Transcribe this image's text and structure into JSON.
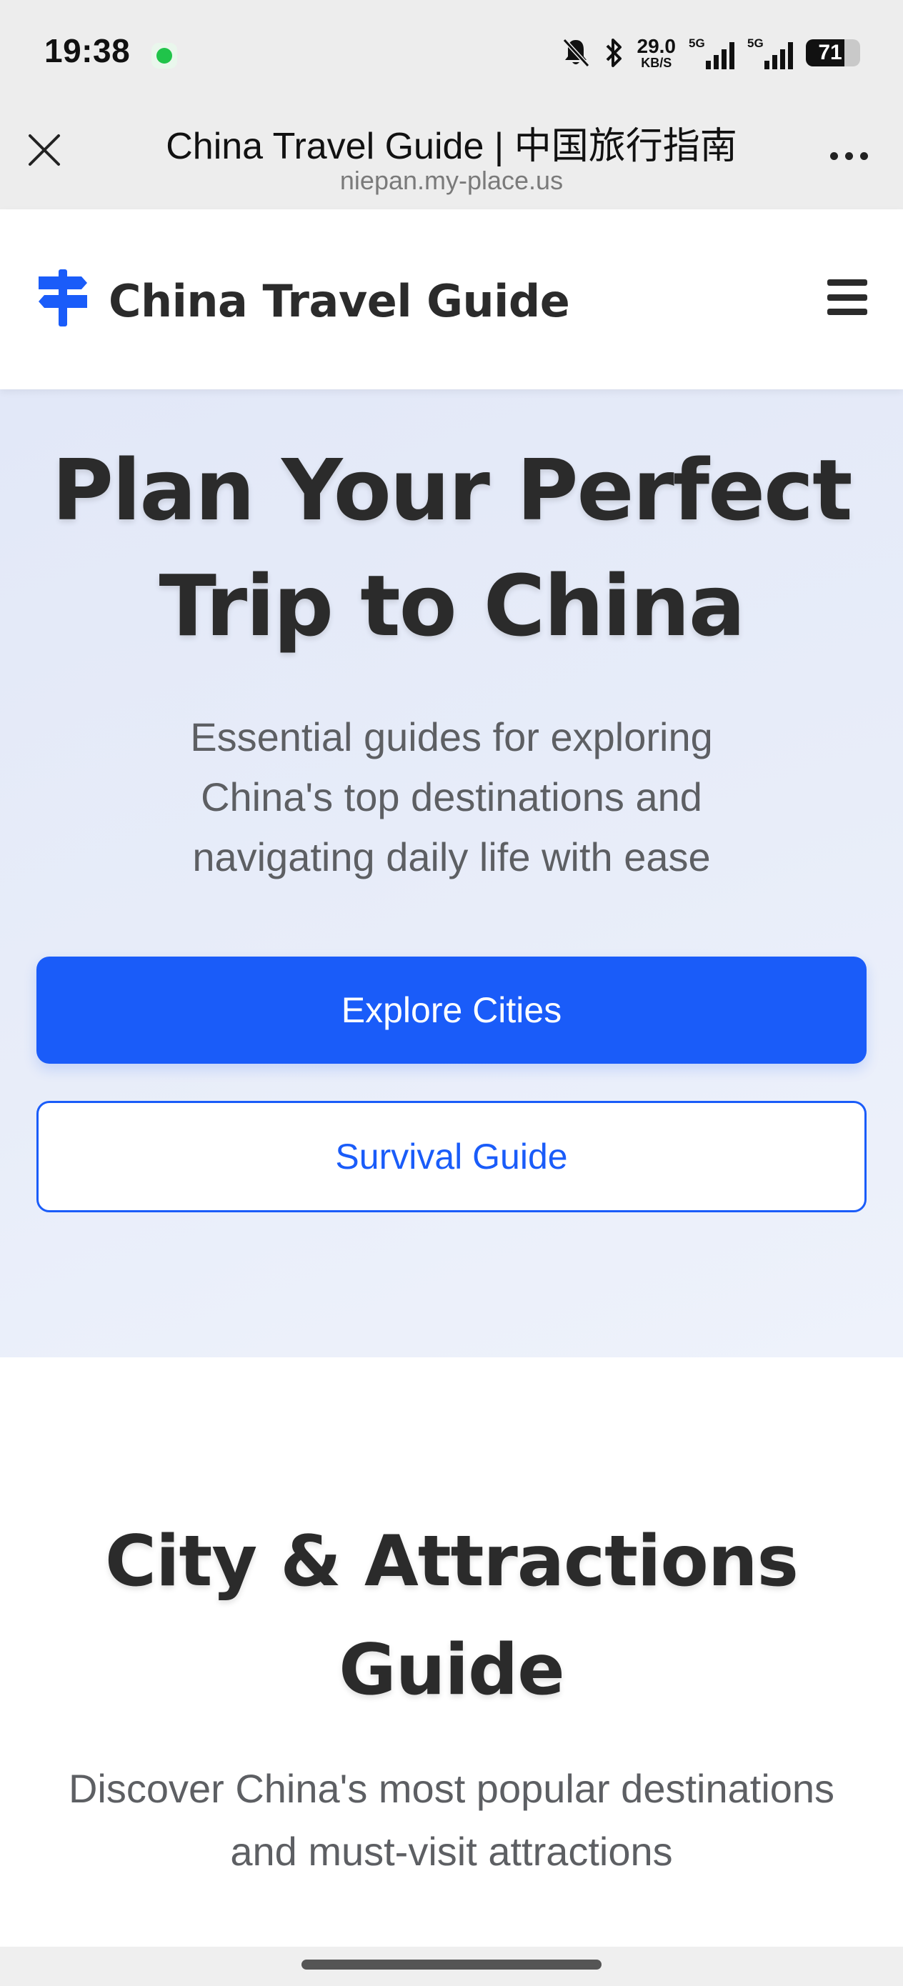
{
  "status_bar": {
    "time": "19:38",
    "speed_value": "29.0",
    "speed_unit": "KB/S",
    "signal_1_label": "5G",
    "signal_2_label": "5G",
    "battery": "71",
    "battery_level": 0.71
  },
  "browser": {
    "title": "China Travel Guide | 中国旅行指南",
    "url": "niepan.my-place.us"
  },
  "header": {
    "brand": "China Travel Guide",
    "accent_color": "#1a5cf9"
  },
  "hero": {
    "title": "Plan Your Perfect Trip to China",
    "subtitle": "Essential guides for exploring China's top destinations and navigating daily life with ease",
    "primary_button": "Explore Cities",
    "secondary_button": "Survival Guide"
  },
  "section": {
    "title": "City & Attractions Guide",
    "subtitle": "Discover China's most popular destinations and must-visit attractions"
  },
  "icons": {
    "logo": "signpost-icon",
    "menu": "hamburger-menu-icon",
    "close": "close-icon",
    "more": "more-options-icon"
  }
}
